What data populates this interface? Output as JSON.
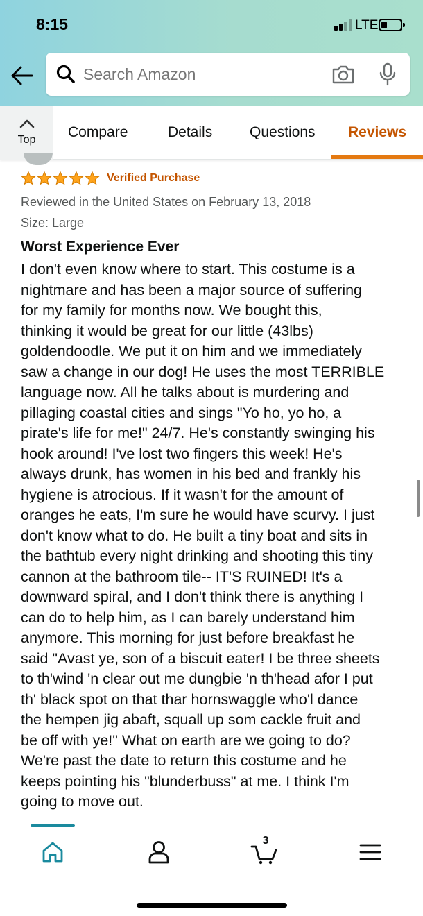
{
  "status_bar": {
    "time": "8:15",
    "network": "LTE",
    "icons": [
      "signal-bars-icon",
      "battery-icon"
    ]
  },
  "search": {
    "placeholder": "Search Amazon",
    "icons": [
      "back-arrow-icon",
      "search-icon",
      "camera-icon",
      "microphone-icon"
    ]
  },
  "tabs": {
    "top_label": "Top",
    "items": [
      {
        "label": "Compare",
        "active": false
      },
      {
        "label": "Details",
        "active": false
      },
      {
        "label": "Questions",
        "active": false
      },
      {
        "label": "Reviews",
        "active": true
      }
    ]
  },
  "review": {
    "rating": 5,
    "rating_max": 5,
    "verified_label": "Verified Purchase",
    "reviewed_line": "Reviewed in the United States on February 13, 2018",
    "size_line": "Size: Large",
    "title": "Worst Experience Ever",
    "body": "I don't even know where to start. This costume is a\nnightmare and has been a major source of suffering\nfor my family for months now. We bought this,\nthinking it would be great for our little (43lbs)\ngoldendoodle. We put it on him and we immediately\nsaw a change in our dog! He uses the most TERRIBLE\nlanguage now. All he talks about is murdering and\npillaging coastal cities and sings \"Yo ho, yo ho, a\npirate's life for me!\" 24/7. He's constantly swinging his\nhook around! I've lost two fingers this week! He's\nalways drunk, has women in his bed and frankly his\nhygiene is atrocious. If it wasn't for the amount of\noranges he eats, I'm sure he would have scurvy. I just\ndon't know what to do. He built a tiny boat and sits in\nthe bathtub every night drinking and shooting this tiny\ncannon at the bathroom tile-- IT'S RUINED! It's a\ndownward spiral, and I don't think there is anything I\ncan do to help him, as I can barely understand him\nanymore. This morning for just before breakfast he\nsaid \"Avast ye, son of a biscuit eater! I be three sheets\nto th'wind 'n clear out me dungbie 'n th'head afor I put\nth' black spot on that thar hornswaggle who'l dance\nthe hempen jig abaft, squall up som cackle fruit and\nbe off with ye!\" What on earth are we going to do?\nWe're past the date to return this costume and he\nkeeps pointing his \"blunderbuss\" at me. I think I'm\ngoing to move out."
  },
  "bottom_nav": {
    "items": [
      "home-icon",
      "account-icon",
      "cart-icon",
      "menu-icon"
    ],
    "cart_count": "3"
  },
  "colors": {
    "accent": "#e47911",
    "active_tab_text": "#c45500",
    "star": "#ffa41c",
    "home_teal": "#1a8a9e"
  }
}
